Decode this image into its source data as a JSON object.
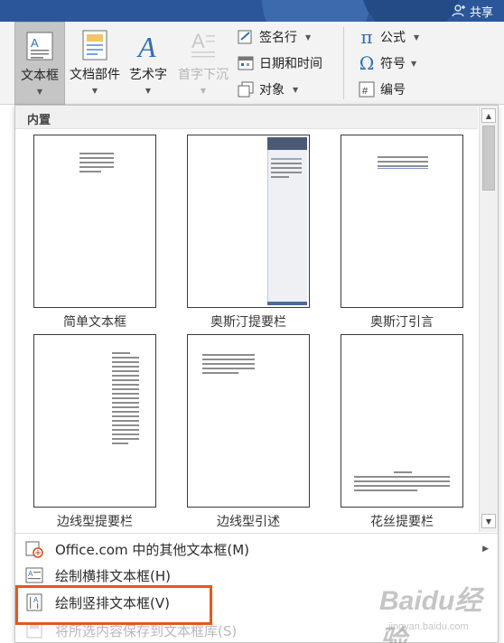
{
  "header": {
    "share_label": "共享"
  },
  "ribbon": {
    "textbox_label": "文本框",
    "quickparts_label": "文档部件",
    "wordart_label": "艺术字",
    "dropcap_label": "首字下沉",
    "signature_label": "签名行",
    "datetime_label": "日期和时间",
    "object_label": "对象",
    "equation_label": "公式",
    "symbol_label": "符号",
    "number_label": "编号"
  },
  "panel": {
    "section_title": "内置",
    "tiles": [
      {
        "caption": "简单文本框"
      },
      {
        "caption": "奥斯汀提要栏"
      },
      {
        "caption": "奥斯汀引言"
      },
      {
        "caption": "边线型提要栏"
      },
      {
        "caption": "边线型引述"
      },
      {
        "caption": "花丝提要栏"
      }
    ],
    "menu": [
      {
        "label": "Office.com 中的其他文本框(M)"
      },
      {
        "label": "绘制横排文本框(H)"
      },
      {
        "label": "绘制竖排文本框(V)"
      },
      {
        "label": "将所选内容保存到文本框库(S)"
      }
    ]
  },
  "watermark": {
    "brand": "Baidu经验",
    "url": "jingyan.baidu.com"
  },
  "colors": {
    "ribbon_blue": "#2b579a",
    "highlight": "#e05a1d",
    "accent_icon": "#2e6fb5"
  }
}
